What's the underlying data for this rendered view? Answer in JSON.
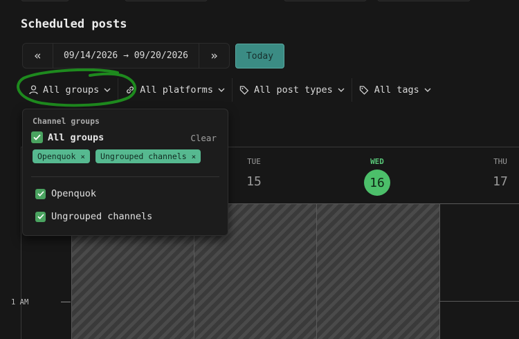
{
  "page": {
    "title": "Scheduled posts"
  },
  "date_nav": {
    "prev": "«",
    "range": "09/14/2026 → 09/20/2026",
    "next": "»",
    "today": "Today"
  },
  "filters": [
    {
      "label": "All groups",
      "icon": "person-icon"
    },
    {
      "label": "All platforms",
      "icon": "link-icon"
    },
    {
      "label": "All post types",
      "icon": "tag-icon"
    },
    {
      "label": "All tags",
      "icon": "tags-icon"
    }
  ],
  "dropdown": {
    "section_label": "Channel groups",
    "all_label": "All groups",
    "clear_label": "Clear",
    "chips": [
      {
        "label": "Openquok",
        "remove": "×"
      },
      {
        "label": "Ungrouped channels",
        "remove": "×"
      }
    ],
    "items": [
      {
        "label": "Openquok",
        "checked": true
      },
      {
        "label": "Ungrouped channels",
        "checked": true
      }
    ]
  },
  "calendar": {
    "days": [
      {
        "dow": "TUE",
        "num": "15",
        "today": false
      },
      {
        "dow": "WED",
        "num": "16",
        "today": true
      },
      {
        "dow": "THU",
        "num": "17",
        "today": false
      }
    ],
    "time_labels": [
      "1 AM"
    ]
  },
  "colors": {
    "accent_green": "#4cbf6a",
    "today_button": "#3b8c84",
    "chip": "#56b990",
    "annotation": "#1e8a1e"
  }
}
